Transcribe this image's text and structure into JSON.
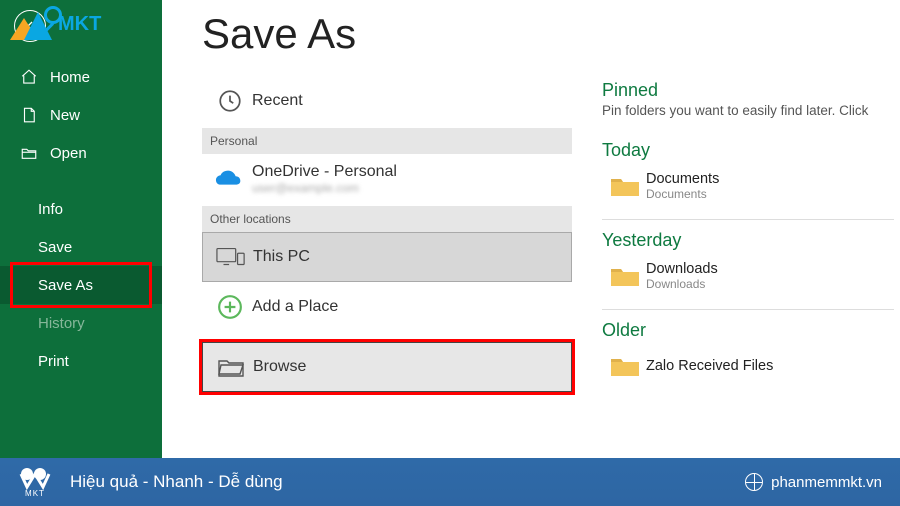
{
  "page_title": "Save As",
  "sidebar": {
    "items": [
      {
        "id": "home",
        "label": "Home",
        "icon": "home-icon"
      },
      {
        "id": "new",
        "label": "New",
        "icon": "file-icon"
      },
      {
        "id": "open",
        "label": "Open",
        "icon": "open-folder-icon"
      }
    ],
    "items2": [
      {
        "id": "info",
        "label": "Info"
      },
      {
        "id": "save",
        "label": "Save"
      },
      {
        "id": "saveas",
        "label": "Save As",
        "active": true
      },
      {
        "id": "history",
        "label": "History",
        "dim": true
      },
      {
        "id": "print",
        "label": "Print"
      }
    ]
  },
  "locations": {
    "recent_label": "Recent",
    "personal_header": "Personal",
    "onedrive": {
      "label": "OneDrive - Personal",
      "sub": "user@example.com"
    },
    "other_header": "Other locations",
    "this_pc_label": "This PC",
    "add_place_label": "Add a Place",
    "browse_label": "Browse"
  },
  "right": {
    "pinned_header": "Pinned",
    "pinned_sub": "Pin folders you want to easily find later. Click",
    "today_header": "Today",
    "yesterday_header": "Yesterday",
    "older_header": "Older",
    "folders": {
      "today": {
        "name": "Documents",
        "path": "Documents"
      },
      "yesterday": {
        "name": "Downloads",
        "path": "Downloads"
      },
      "older": {
        "name": "Zalo Received Files",
        "path": ""
      }
    }
  },
  "watermark": {
    "brand": "MKT"
  },
  "footer": {
    "brand": "MKT",
    "tagline": "Hiệu quả - Nhanh  - Dễ dùng",
    "site": "phanmemmkt.vn"
  },
  "colors": {
    "excel_green": "#0d6f3b",
    "accent_green": "#0e7a40"
  }
}
